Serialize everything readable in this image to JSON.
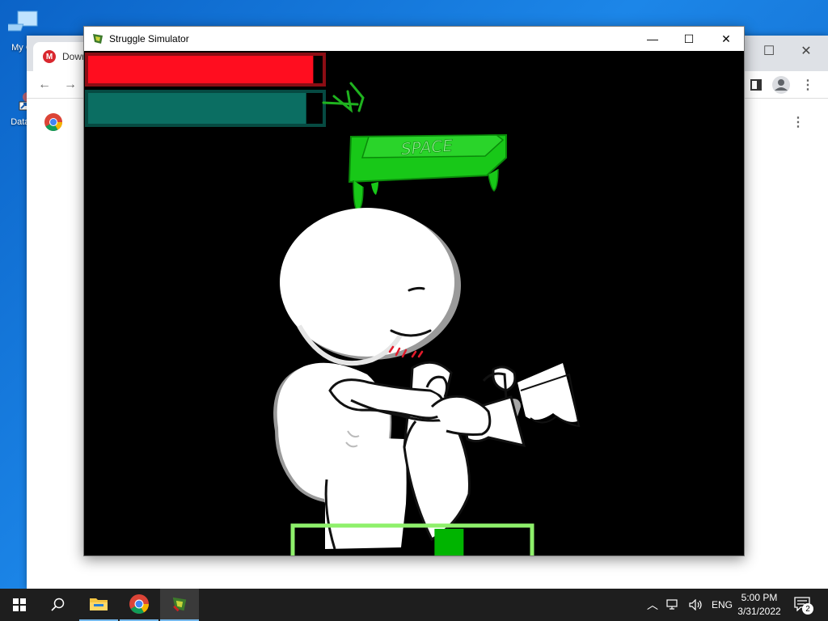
{
  "desktop": {
    "icons": [
      {
        "label": "My Co",
        "icon": "computer-icon"
      },
      {
        "label": "DataW",
        "icon": "shortcut-icon"
      }
    ]
  },
  "chrome": {
    "tab_title": "Down",
    "icons": [
      "mega-icon",
      "back-arrow-icon",
      "forward-arrow-icon",
      "chrome-logo-icon",
      "sidepanel-icon",
      "profile-icon",
      "menu-kebab-icon"
    ]
  },
  "game_window": {
    "title": "Struggle Simulator",
    "icon": "struggle-simulator-icon",
    "controls": [
      "minimize-icon",
      "maximize-icon",
      "close-icon"
    ]
  },
  "game": {
    "health_bar": {
      "fill": 0.96,
      "color": "#ff0d1f",
      "border": "#8c0d14"
    },
    "stamina_bar": {
      "fill": 0.93,
      "color": "#0b6e62",
      "border": "#064a42"
    },
    "space_key_label": "SPACE",
    "timing_bar": {
      "marker_position": 0.68,
      "marker_color": "#00b400",
      "border_color": "#8ef06b"
    }
  },
  "taskbar": {
    "icons": [
      "windows-start-icon",
      "search-icon",
      "file-explorer-icon",
      "chrome-icon",
      "struggle-simulator-icon"
    ],
    "tray_icons": [
      "chevron-up-icon",
      "network-icon",
      "volume-icon"
    ],
    "language": "ENG",
    "time": "5:00 PM",
    "date": "3/31/2022",
    "notification_count": "2"
  }
}
